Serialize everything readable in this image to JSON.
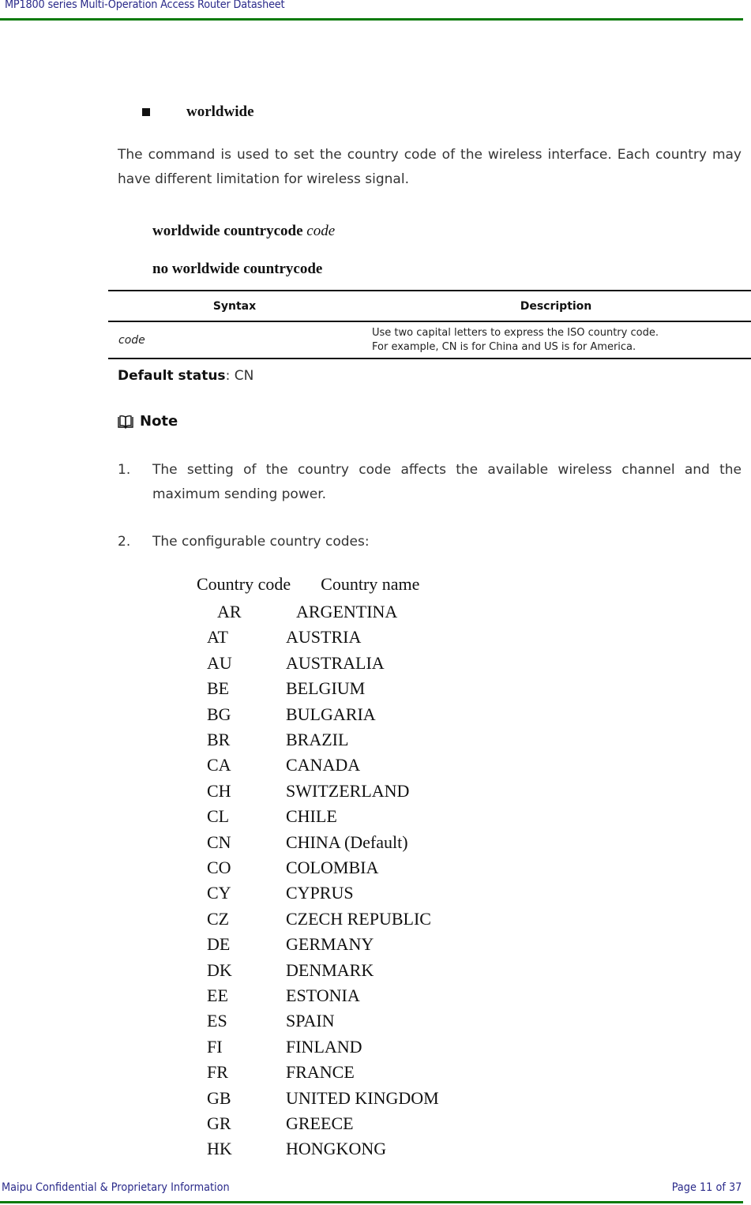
{
  "header": {
    "title": "MP1800 series Multi-Operation Access Router Datasheet"
  },
  "section": {
    "heading": "worldwide",
    "intro": "The command is used to set the country code of the wireless interface. Each country may have different limitation for wireless signal.",
    "commands": [
      {
        "keyword": "worldwide countrycode",
        "argument": "code"
      },
      {
        "keyword": "no worldwide countrycode",
        "argument": ""
      }
    ],
    "syntax_table": {
      "headers": [
        "Syntax",
        "Description"
      ],
      "rows": [
        {
          "syntax": "code",
          "description_line1": "Use two capital letters to express the ISO country code.",
          "description_line2": "For example, CN is for China and US is for America."
        }
      ]
    },
    "default_status": {
      "label": "Default status",
      "value": ": CN"
    },
    "note": {
      "icon": "book-icon",
      "title": "Note",
      "items": [
        {
          "number": "1.",
          "text": "The setting of the country code affects the available wireless channel and the maximum sending power."
        },
        {
          "number": "2.",
          "text": "The configurable country codes:"
        }
      ]
    },
    "country_codes": {
      "header_code": "Country code",
      "header_name": "Country name",
      "rows": [
        {
          "code": "AR",
          "name": "ARGENTINA"
        },
        {
          "code": "AT",
          "name": "AUSTRIA"
        },
        {
          "code": "AU",
          "name": "AUSTRALIA"
        },
        {
          "code": "BE",
          "name": "BELGIUM"
        },
        {
          "code": "BG",
          "name": "BULGARIA"
        },
        {
          "code": "BR",
          "name": "BRAZIL"
        },
        {
          "code": "CA",
          "name": "CANADA"
        },
        {
          "code": "CH",
          "name": "SWITZERLAND"
        },
        {
          "code": "CL",
          "name": "CHILE"
        },
        {
          "code": "CN",
          "name": "CHINA (Default)"
        },
        {
          "code": "CO",
          "name": "COLOMBIA"
        },
        {
          "code": "CY",
          "name": "CYPRUS"
        },
        {
          "code": "CZ",
          "name": "CZECH REPUBLIC"
        },
        {
          "code": "DE",
          "name": "GERMANY"
        },
        {
          "code": "DK",
          "name": "DENMARK"
        },
        {
          "code": "EE",
          "name": "ESTONIA"
        },
        {
          "code": "ES",
          "name": "SPAIN"
        },
        {
          "code": "FI",
          "name": "FINLAND"
        },
        {
          "code": "FR",
          "name": "FRANCE"
        },
        {
          "code": "GB",
          "name": "UNITED KINGDOM"
        },
        {
          "code": "GR",
          "name": "GREECE"
        },
        {
          "code": "HK",
          "name": "HONGKONG"
        }
      ]
    }
  },
  "footer": {
    "left": "Maipu Confidential & Proprietary Information",
    "right": "Page 11 of 37"
  },
  "colors": {
    "header_text": "#2a2a8a",
    "rule": "#0a7a0a"
  }
}
